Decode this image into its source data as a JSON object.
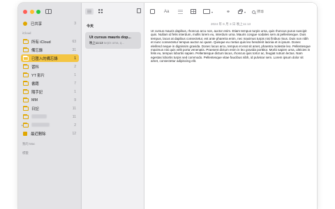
{
  "sidebar": {
    "shared": {
      "label": "已共享",
      "count": "3"
    },
    "icloud_header": "iCloud",
    "folders": [
      {
        "label": "所有 iCloud",
        "count": "63"
      },
      {
        "label": "備忘錄",
        "count": "31"
      },
      {
        "label": "已匯入的備忘錄",
        "count": "1",
        "active": true
      },
      {
        "label": "習科",
        "count": "2"
      },
      {
        "label": "YT 影片",
        "count": "1"
      },
      {
        "label": "書籍",
        "count": "7"
      },
      {
        "label": "隨手記",
        "count": "1"
      },
      {
        "label": "MM",
        "count": "9"
      },
      {
        "label": "日記",
        "count": "11"
      },
      {
        "label": "",
        "count": "11"
      },
      {
        "label": "",
        "count": "2"
      }
    ],
    "recently_deleted": {
      "label": "最近刪除",
      "count": "12"
    },
    "section_mac": "我的 Mac",
    "section_tags": "標籤"
  },
  "notes_list": {
    "section": "今天",
    "notes": [
      {
        "title": "Ut cursus mauris dop...",
        "time": "晚上11:13",
        "snippet": "turpis urna, q..."
      }
    ]
  },
  "editor": {
    "date": "2024 年 6 月 3 日 晚上11:13",
    "body": "Ut cursus mauris dapibus, rhoncus arcu non, auctor enim. Etiam tempus turpis urna, quis rhoncus purus suscipit quis. Nullam id felis interdum, mollis lorem eu, interdum urna. Mauris congue sodales sem at pellentesque. Duis tempus, lacus at dapibus consectetur, est ante pharetra enim, nec maximus turpis nisi finibus risus. Duis non nibh et nunc consectetur tempus auctor ac quam. Quisque eu metus quis leo hendrerit lacinia et in ipsum. Donec eleifend neque in dignissim gravida. Donec lacus arcu, tempus et erat sit amet, pharetra molestie leo. Pellentesque maximus nisi quis velit porta venenatis. Praesent dictum enim in leo gravida porttitor. Morbi sapien urna, ultricies in felis eu, tempus lobortis sapien. Pellentesque dictum lacus, rhoncus quis tortor ac, feugiat rutrum lectus. Nam egestas lobortis turpis sed commodo. Pellentesque vitae faucibus nibh, id pulvinar sem. Lorem ipsum dolor sit amet, consectetur adipiscing elit.",
    "toolbar": {
      "format_label": "Aa"
    },
    "search": {
      "placeholder": "搜尋"
    }
  },
  "colors": {
    "accent": "#f4c542",
    "folder_icon": "#e0a700"
  }
}
